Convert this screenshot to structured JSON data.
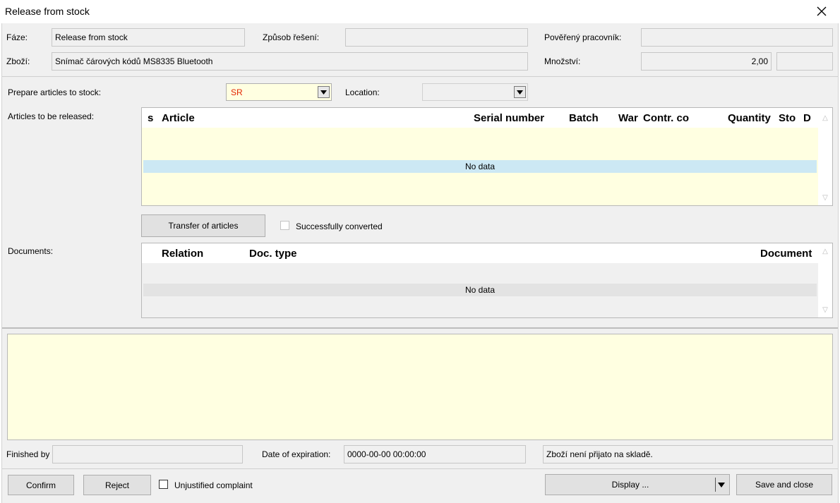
{
  "window": {
    "title": "Release from stock"
  },
  "header": {
    "phase_label": "Fáze:",
    "phase_value": "Release from stock",
    "method_label": "Způsob řešení:",
    "method_value": "",
    "assignee_label": "Pověřený pracovník:",
    "assignee_value": "",
    "goods_label": "Zboží:",
    "goods_value": "Snímač čárových kódů MS8335 Bluetooth",
    "quantity_label": "Množství:",
    "quantity_value": "2,00",
    "unit_value": ""
  },
  "prepare": {
    "label": "Prepare articles to stock:",
    "value": "SR",
    "location_label": "Location:",
    "location_value": ""
  },
  "articles": {
    "label": "Articles to be released:",
    "columns": [
      "s",
      "Article",
      "Serial number",
      "Batch",
      "War",
      "Contr. co",
      "Quantity",
      "Sto",
      "D"
    ],
    "no_data": "No data"
  },
  "transfer": {
    "button_label": "Transfer of articles",
    "converted_label": "Successfully converted",
    "converted_checked": false
  },
  "documents": {
    "label": "Documents:",
    "columns": [
      "Relation",
      "Doc. type",
      "Document"
    ],
    "no_data": "No data"
  },
  "footer": {
    "finished_by_label": "Finished by",
    "finished_by_value": "",
    "expiration_label": "Date of expiration:",
    "expiration_value": "0000-00-00 00:00:00",
    "status_value": "Zboží není přijato na skladě."
  },
  "actions": {
    "confirm_label": "Confirm",
    "reject_label": "Reject",
    "unjustified_label": "Unjustified complaint",
    "unjustified_checked": false,
    "display_label": "Display ...",
    "save_close_label": "Save and close"
  },
  "colors": {
    "editable_background": "#ffffe1",
    "selected_row": "#cce8f4",
    "combo_text": "#e32400"
  }
}
